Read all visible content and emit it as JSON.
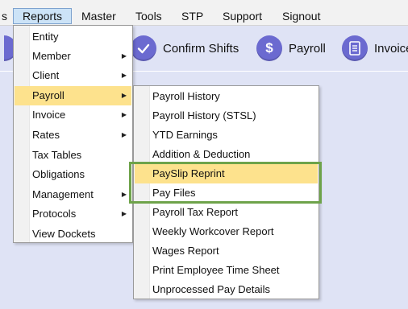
{
  "menubar": {
    "items": [
      {
        "label": "s"
      },
      {
        "label": "Reports"
      },
      {
        "label": "Master"
      },
      {
        "label": "Tools"
      },
      {
        "label": "STP"
      },
      {
        "label": "Support"
      },
      {
        "label": "Signout"
      }
    ]
  },
  "toolbar": {
    "buttons": [
      {
        "label": "Confirm Shifts",
        "icon": "check-icon"
      },
      {
        "label": "Payroll",
        "icon": "dollar-icon"
      },
      {
        "label": "Invoice",
        "icon": "invoice-icon"
      }
    ]
  },
  "reports_menu": {
    "items": [
      {
        "label": "Entity",
        "has_submenu": false
      },
      {
        "label": "Member",
        "has_submenu": true
      },
      {
        "label": "Client",
        "has_submenu": true
      },
      {
        "label": "Payroll",
        "has_submenu": true,
        "selected": true
      },
      {
        "label": "Invoice",
        "has_submenu": true
      },
      {
        "label": "Rates",
        "has_submenu": true
      },
      {
        "label": "Tax Tables",
        "has_submenu": false
      },
      {
        "label": "Obligations",
        "has_submenu": false
      },
      {
        "label": "Management",
        "has_submenu": true
      },
      {
        "label": "Protocols",
        "has_submenu": true
      },
      {
        "label": "View Dockets",
        "has_submenu": false
      }
    ]
  },
  "payroll_submenu": {
    "items": [
      {
        "label": "Payroll History"
      },
      {
        "label": "Payroll History (STSL)"
      },
      {
        "label": "YTD Earnings"
      },
      {
        "label": "Addition & Deduction"
      },
      {
        "label": "PaySlip Reprint",
        "selected": true
      },
      {
        "label": "Pay Files"
      },
      {
        "label": "Payroll Tax Report"
      },
      {
        "label": "Weekly Workcover Report"
      },
      {
        "label": "Wages Report"
      },
      {
        "label": "Print Employee Time Sheet"
      },
      {
        "label": "Unprocessed Pay Details"
      }
    ]
  },
  "colors": {
    "background": "#dfe3f5",
    "menubar_active": "#cce3f7",
    "menu_selection": "#fde28d",
    "highlight_box": "#6ea34a",
    "toolbar_icon": "#6b6ad0"
  }
}
